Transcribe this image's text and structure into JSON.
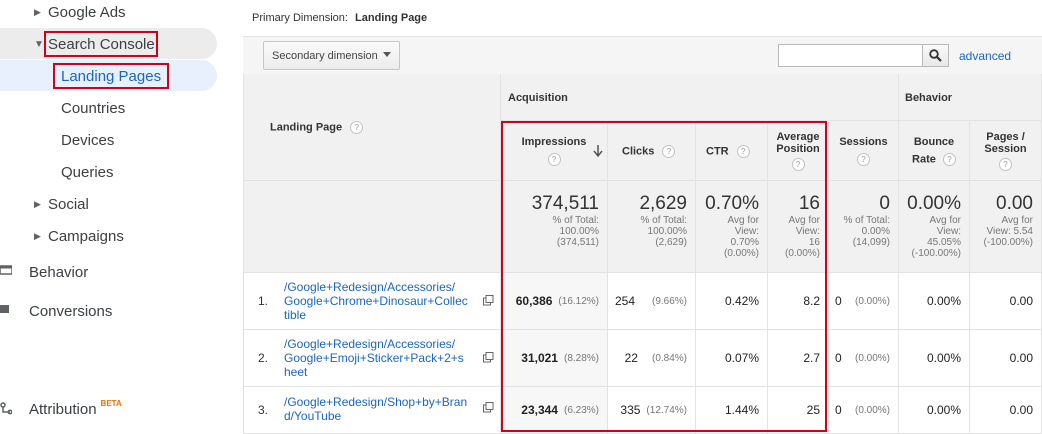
{
  "sidebar": {
    "google_ads": "Google Ads",
    "search_console": "Search Console",
    "landing_pages": "Landing Pages",
    "countries": "Countries",
    "devices": "Devices",
    "queries": "Queries",
    "social": "Social",
    "campaigns": "Campaigns",
    "behavior": "Behavior",
    "conversions": "Conversions",
    "attribution": "Attribution",
    "attribution_badge": "BETA"
  },
  "primary_dimension": {
    "label": "Primary Dimension:",
    "value": "Landing Page"
  },
  "toolbar": {
    "secondary_dimension": "Secondary dimension",
    "advanced": "advanced",
    "search_value": ""
  },
  "table": {
    "header": {
      "landing_page": "Landing Page",
      "acquisition": "Acquisition",
      "behavior": "Behavior",
      "impressions": "Impressions",
      "clicks": "Clicks",
      "ctr": "CTR",
      "avg_position_1": "Average",
      "avg_position_2": "Position",
      "sessions": "Sessions",
      "bounce_1": "Bounce",
      "bounce_2": "Rate",
      "pages_1": "Pages /",
      "pages_2": "Session"
    },
    "totals": {
      "impressions": {
        "big": "374,511",
        "l1": "% of Total:",
        "l2": "100.00%",
        "l3": "(374,511)"
      },
      "clicks": {
        "big": "2,629",
        "l1": "% of Total:",
        "l2": "100.00%",
        "l3": "(2,629)"
      },
      "ctr": {
        "big": "0.70%",
        "l1": "Avg for",
        "l2": "View:",
        "l3": "0.70%",
        "l4": "(0.00%)"
      },
      "avg_position": {
        "big": "16",
        "l1": "Avg for",
        "l2": "View:",
        "l3": "16",
        "l4": "(0.00%)"
      },
      "sessions": {
        "big": "0",
        "l1": "% of Total:",
        "l2": "0.00%",
        "l3": "(14,099)"
      },
      "bounce": {
        "big": "0.00%",
        "l1": "Avg for",
        "l2": "View:",
        "l3": "45.05%",
        "l4": "(-100.00%)"
      },
      "pages": {
        "big": "0.00",
        "l1": "Avg for",
        "l2": "View: 5.54",
        "l3": "(-100.00%)"
      }
    },
    "rows": [
      {
        "num": "1.",
        "page_l1": "/Google+Redesign/Accessories/",
        "page_l2": "Google+Chrome+Dinosaur+Collec",
        "page_l3": "tible",
        "impressions": "60,386",
        "impressions_pct": "(16.12%)",
        "clicks": "254",
        "clicks_pct": "(9.66%)",
        "ctr": "0.42%",
        "avg_position": "8.2",
        "sessions": "0",
        "sessions_pct": "(0.00%)",
        "bounce": "0.00%",
        "pages": "0.00"
      },
      {
        "num": "2.",
        "page_l1": "/Google+Redesign/Accessories/",
        "page_l2": "Google+Emoji+Sticker+Pack+2+s",
        "page_l3": "heet",
        "impressions": "31,021",
        "impressions_pct": "(8.28%)",
        "clicks": "22",
        "clicks_pct": "(0.84%)",
        "ctr": "0.07%",
        "avg_position": "2.7",
        "sessions": "0",
        "sessions_pct": "(0.00%)",
        "bounce": "0.00%",
        "pages": "0.00"
      },
      {
        "num": "3.",
        "page_l1": "/Google+Redesign/Shop+by+Bran",
        "page_l2": "d/YouTube",
        "page_l3": "",
        "impressions": "23,344",
        "impressions_pct": "(6.23%)",
        "clicks": "335",
        "clicks_pct": "(12.74%)",
        "ctr": "1.44%",
        "avg_position": "25",
        "sessions": "0",
        "sessions_pct": "(0.00%)",
        "bounce": "0.00%",
        "pages": "0.00"
      }
    ]
  },
  "colors": {
    "highlight": "#d0021b",
    "link": "#1a66c2",
    "selected_bg": "#e8f0fe"
  }
}
